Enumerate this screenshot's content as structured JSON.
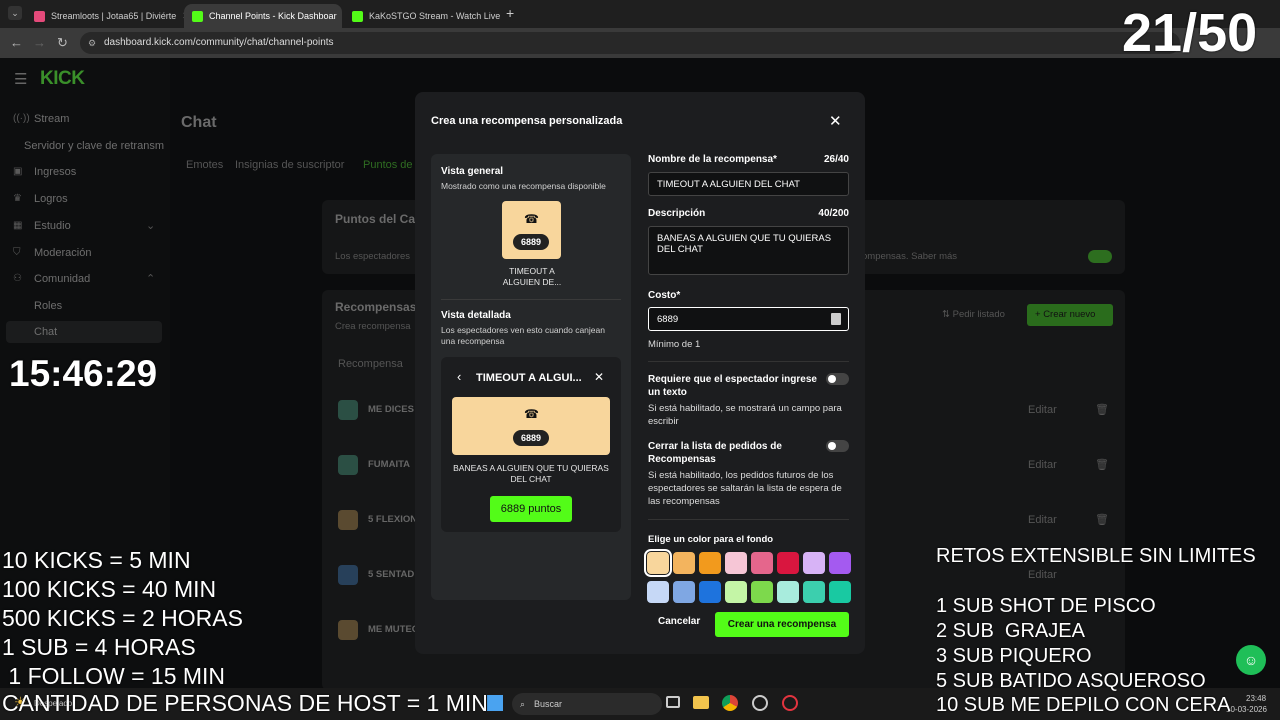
{
  "browser": {
    "tabs": [
      {
        "label": "Streamloots | Jotaa65 | Diviérte",
        "active": false
      },
      {
        "label": "Channel Points - Kick Dashboar",
        "active": true
      },
      {
        "label": "KaKoSTGO Stream - Watch Live",
        "active": false
      }
    ],
    "url": "dashboard.kick.com/community/chat/channel-points"
  },
  "kick": {
    "logo": "KICK",
    "sidebar": [
      {
        "label": "Stream",
        "icon": "stream-icon"
      },
      {
        "label": "Servidor y clave de retransm",
        "icon": ""
      },
      {
        "label": "Ingresos",
        "icon": "dollar-icon"
      },
      {
        "label": "Logros",
        "icon": "trophy-icon"
      },
      {
        "label": "Estudio",
        "icon": "studio-icon"
      },
      {
        "label": "Moderación",
        "icon": "shield-icon"
      },
      {
        "label": "Comunidad",
        "icon": "users-icon"
      },
      {
        "label": "Roles",
        "icon": ""
      },
      {
        "label": "Chat",
        "icon": ""
      }
    ],
    "page_title": "Chat",
    "tabs": [
      "Emotes",
      "Insignias de suscriptor",
      "Puntos de"
    ],
    "section_title": "Puntos del Ca",
    "section_desc": "Los espectadores",
    "section_desc_right": "ompensas. Saber más",
    "rewards_title": "Recompensas",
    "rewards_sub": "Crea recompensa",
    "rewards_col": "Recompensa",
    "pedir_listado": "Pedir listado",
    "crear_nuevo": "Crear nuevo",
    "rows": [
      "ME DICES",
      "FUMAITA",
      "5 FLEXION",
      "5 SENTAD",
      "ME MUTEO"
    ],
    "edit_label": "Editar"
  },
  "modal": {
    "title": "Crea una recompensa personalizada",
    "preview": {
      "general_title": "Vista general",
      "general_sub": "Mostrado como una recompensa disponible",
      "tile_cost": "6889",
      "tile_label": "TIMEOUT A ALGUIEN DE...",
      "detail_title": "Vista detallada",
      "detail_sub": "Los espectadores ven esto cuando canjean una recompensa",
      "detail_header": "TIMEOUT A ALGUI...",
      "detail_cost": "6889",
      "detail_desc": "BANEAS A ALGUIEN QUE TU QUIERAS DEL CHAT",
      "detail_button": "6889 puntos"
    },
    "form": {
      "name_label": "Nombre de la recompensa*",
      "name_count": "26/40",
      "name_value": "TIMEOUT A ALGUIEN DEL CHAT",
      "desc_label": "Descripción",
      "desc_count": "40/200",
      "desc_value": "BANEAS A ALGUIEN QUE TU QUIERAS DEL CHAT",
      "cost_label": "Costo*",
      "cost_value": "6889",
      "cost_help": "Mínimo de 1",
      "toggle1_label": "Requiere que el espectador ingrese un texto",
      "toggle1_help": "Si está habilitado, se mostrará un campo para escribir",
      "toggle1_on": false,
      "toggle2_label": "Cerrar la lista de pedidos de Recompensas",
      "toggle2_help": "Si está habilitado, los pedidos futuros de los espectadores se saltarán la lista de espera de las recompensas",
      "toggle2_on": false,
      "color_label": "Elige un color para el fondo",
      "colors": [
        "#f8d69c",
        "#f3b45e",
        "#f29a1d",
        "#f6c6d6",
        "#e5668c",
        "#d9163f",
        "#d7b3f6",
        "#a45af0",
        "#c6d8f6",
        "#7fa7e3",
        "#1e73dd",
        "#c4f5a6",
        "#7dd94c",
        "#a8ecdd",
        "#3ccfae",
        "#19c9a2"
      ],
      "selected_color": "#f8d69c"
    },
    "cancel_label": "Cancelar",
    "create_label": "Crear una recompensa"
  },
  "overlay": {
    "counter": "21/50",
    "clock": "15:46:29",
    "left_lines": [
      "10 KICKS = 5 MIN",
      "100 KICKS = 40 MIN",
      "500 KICKS = 2 HORAS",
      "1 SUB = 4 HORAS",
      " 1 FOLLOW = 15 MIN"
    ],
    "bottom_line": "CANTIDAD DE PERSONAS DE HOST = 1 MIN",
    "right_title": "RETOS EXTENSIBLE SIN LIMITES",
    "right_lines": [
      "1 SUB SHOT DE PISCO",
      "2 SUB  GRAJEA",
      "3 SUB PIQUERO",
      "5 SUB BATIDO ASQUEROSO",
      "10 SUB ME DEPILO CON CERA"
    ]
  },
  "taskbar": {
    "search": "Buscar",
    "weather": "Despejado",
    "time": "23:48",
    "date": "10-03-2026"
  }
}
